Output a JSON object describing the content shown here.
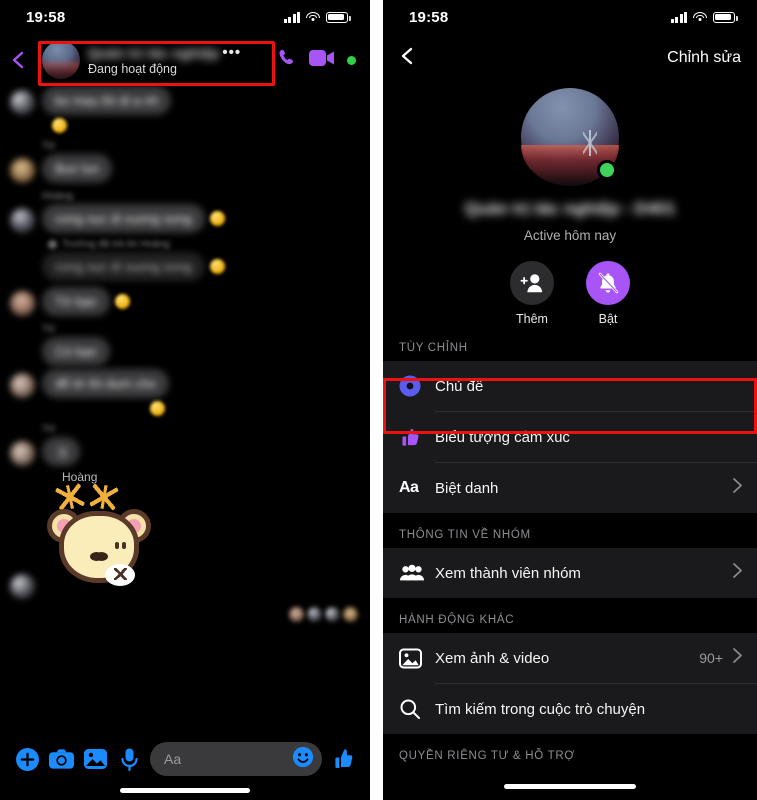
{
  "status_bar": {
    "time": "19:58",
    "signal_icon": "cellular-bars-icon",
    "wifi_icon": "wifi-icon",
    "battery_icon": "battery-icon"
  },
  "left_panel": {
    "header": {
      "back_icon": "back-chevron-icon",
      "group_name": "Quản trị tác nghiệp",
      "overflow_dots": "•••",
      "status": "Đang hoạt động",
      "call_icon": "phone-call-icon",
      "video_icon": "video-camera-icon",
      "active_dot": "online-dot",
      "highlight_color": "#ee1111"
    },
    "messages": [
      {
        "sender": "",
        "text": "bo mau thi di a nh",
        "type": "incoming",
        "reaction": true
      },
      {
        "sender": "Tớ",
        "text": "Bun lun",
        "type": "incoming"
      },
      {
        "sender": "Hoàng",
        "text": "cong suc di xuong song",
        "type": "incoming",
        "reaction": true
      },
      {
        "sender": "Trường đã trả lời Hoàng",
        "text": "cong suc di xuong song",
        "type": "reply",
        "reaction": true
      },
      {
        "sender": "",
        "text": "Tớ bạn",
        "type": "incoming",
        "reaction": true
      },
      {
        "sender": "Tớ",
        "text": "Có bạn",
        "type": "incoming"
      },
      {
        "sender": "",
        "text": "để tớ thi dum cho",
        "type": "incoming",
        "reaction": true
      },
      {
        "sender": "Tớ",
        "text": ":))",
        "type": "incoming"
      }
    ],
    "sticker": {
      "sender": "Hoàng",
      "name": "bear-sticker"
    },
    "seen_by_count": 4,
    "composer": {
      "plus_icon": "plus-circle-icon",
      "camera_icon": "camera-icon",
      "gallery_icon": "image-gallery-icon",
      "mic_icon": "microphone-icon",
      "input_placeholder": "Aa",
      "emoji_icon": "emoji-smiley-icon",
      "like_icon": "thumbs-up-icon",
      "accent_color": "#1a8cff"
    }
  },
  "right_panel": {
    "nav": {
      "back_icon": "back-chevron-icon",
      "edit_label": "Chỉnh sửa"
    },
    "profile": {
      "avatar_icon": "group-avatar",
      "online_indicator": "online-dot",
      "name": "Quản trị tác nghiệp - D401",
      "subtitle": "Active hôm nay"
    },
    "quick_actions": [
      {
        "icon": "add-person-icon",
        "label": "Thêm",
        "style": "grey"
      },
      {
        "icon": "bell-muted-icon",
        "label": "Bật",
        "style": "purple"
      }
    ],
    "sections": [
      {
        "title": "TÙY CHỈNH",
        "rows": [
          {
            "icon": "theme-color-circle-icon",
            "label": "Chủ đề",
            "meta": "",
            "chevron": false,
            "highlighted": true
          },
          {
            "icon": "thumbs-up-icon",
            "label": "Biểu tượng cảm xúc",
            "meta": "",
            "chevron": false,
            "highlighted": false
          },
          {
            "icon": "aa-text-icon",
            "label": "Biệt danh",
            "meta": "",
            "chevron": true,
            "highlighted": false
          }
        ]
      },
      {
        "title": "THÔNG TIN VỀ NHÓM",
        "rows": [
          {
            "icon": "people-group-icon",
            "label": "Xem thành viên nhóm",
            "meta": "",
            "chevron": true,
            "highlighted": false
          }
        ]
      },
      {
        "title": "HÀNH ĐỘNG KHÁC",
        "rows": [
          {
            "icon": "photo-icon",
            "label": "Xem ảnh & video",
            "meta": "90+",
            "chevron": true,
            "highlighted": false
          },
          {
            "icon": "search-icon",
            "label": "Tìm kiếm trong cuộc trò chuyện",
            "meta": "",
            "chevron": false,
            "highlighted": false
          }
        ]
      },
      {
        "title": "QUYỀN RIÊNG TƯ & HỖ TRỢ",
        "rows": []
      }
    ],
    "highlight_color": "#ee1111"
  },
  "colors": {
    "accent_purple": "#a855f7",
    "accent_blue": "#1a8cff",
    "theme_blue": "#5b5bf0",
    "online_green": "#3fd35a",
    "highlight_red": "#ee1111"
  }
}
